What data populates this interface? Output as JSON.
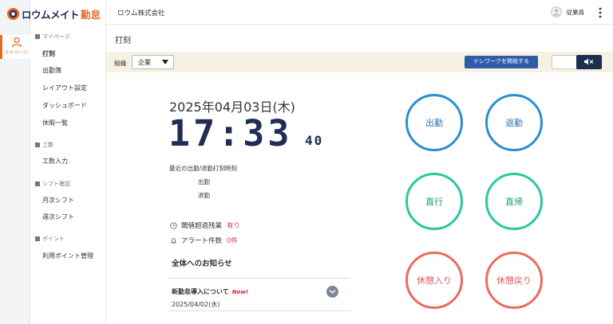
{
  "brand": {
    "name": "ロウムメイト",
    "product": "勤怠"
  },
  "rail": {
    "my_page": "マイページ"
  },
  "menu": {
    "sections": [
      {
        "title": "マイページ",
        "items": [
          "打刻",
          "出勤簿",
          "レイアウト設定",
          "ダッシュボード",
          "休暇一覧"
        ]
      },
      {
        "title": "工数",
        "items": [
          "工数入力"
        ]
      },
      {
        "title": "シフト確認",
        "items": [
          "月次シフト",
          "週次シフト"
        ]
      },
      {
        "title": "ポイント",
        "items": [
          "利用ポイント管理"
        ]
      }
    ]
  },
  "header": {
    "company": "ロウム株式会社",
    "user": "従業員",
    "more": "⋮"
  },
  "page": {
    "title": "打刻"
  },
  "filter": {
    "org_label": "組織",
    "org_value": "企業",
    "telework_button": "テレワークを開始する",
    "mute_icon": "◀×"
  },
  "clock": {
    "date": "2025年04月03日(木)",
    "time": "17:33",
    "seconds": "40"
  },
  "recent": {
    "title": "最近の出勤/退勤打刻時刻",
    "in": "出勤",
    "out": "退勤"
  },
  "stats": [
    {
      "label": "閾値超過残業",
      "value": "有り",
      "icon": "clock-icon"
    },
    {
      "label": "アラート件数",
      "value": "0件",
      "icon": "bell-icon"
    }
  ],
  "news": {
    "heading": "全体へのお知らせ",
    "item_title": "新勤怠導入について",
    "new_badge": "New!",
    "item_date": "2025/04/02(水)"
  },
  "punch": {
    "clock_in": "出勤",
    "clock_out": "退勤",
    "direct_go": "直行",
    "direct_return": "直帰",
    "break_start": "休憩入り",
    "break_end": "休憩戻り"
  },
  "colors": {
    "accent": "#e46a25",
    "navy": "#1f2d57",
    "blue_button": "#2f5ba8",
    "alert": "#d8365c"
  }
}
